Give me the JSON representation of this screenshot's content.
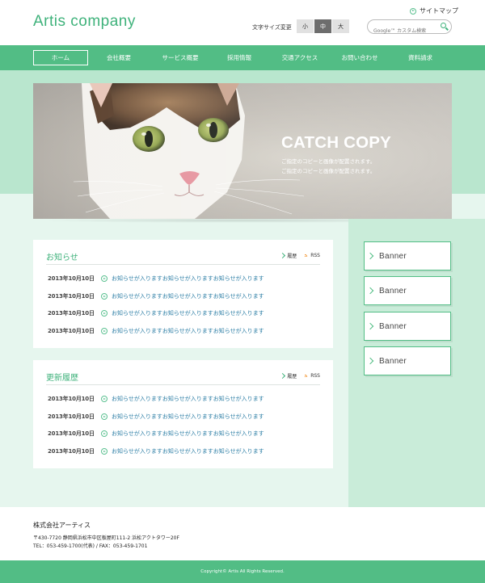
{
  "header": {
    "logo": "Artis company",
    "sitemap": "サイトマップ",
    "font_size_label": "文字サイズ変更",
    "font_sizes": [
      "小",
      "中",
      "大"
    ],
    "active_font_size": "中",
    "search_placeholder": "Google™ カスタム検索"
  },
  "nav": {
    "items": [
      "ホーム",
      "会社概要",
      "サービス概要",
      "採用情報",
      "交通アクセス",
      "お問い合わせ",
      "資料請求"
    ],
    "active": "ホーム"
  },
  "hero": {
    "catch_copy": "CATCH COPY",
    "sub_lines": [
      "ご指定のコピーと画像が配置されます。",
      "ご指定のコピーと画像が配置されます。"
    ]
  },
  "news": {
    "title": "お知らせ",
    "history_link": "履歴",
    "rss_link": "RSS",
    "items": [
      {
        "date": "2013年10月10日",
        "text": "お知らせが入りますお知らせが入りますお知らせが入ります"
      },
      {
        "date": "2013年10月10日",
        "text": "お知らせが入りますお知らせが入りますお知らせが入ります"
      },
      {
        "date": "2013年10月10日",
        "text": "お知らせが入りますお知らせが入りますお知らせが入ります"
      },
      {
        "date": "2013年10月10日",
        "text": "お知らせが入りますお知らせが入りますお知らせが入ります"
      }
    ]
  },
  "updates": {
    "title": "更新履歴",
    "history_link": "履歴",
    "rss_link": "RSS",
    "items": [
      {
        "date": "2013年10月10日",
        "text": "お知らせが入りますお知らせが入りますお知らせが入ります"
      },
      {
        "date": "2013年10月10日",
        "text": "お知らせが入りますお知らせが入りますお知らせが入ります"
      },
      {
        "date": "2013年10月10日",
        "text": "お知らせが入りますお知らせが入りますお知らせが入ります"
      },
      {
        "date": "2013年10月10日",
        "text": "お知らせが入りますお知らせが入りますお知らせが入ります"
      }
    ]
  },
  "banners": [
    "Banner",
    "Banner",
    "Banner",
    "Banner"
  ],
  "footer": {
    "company": "株式会社アーティス",
    "address": "〒430-7720 静岡県浜松市中区板屋町111-2 浜松アクトタワー20F",
    "tel": "TEL：053-459-1700(代表) / FAX：053-459-1701",
    "copyright": "Copyright© Artis All Rights Reserved."
  },
  "colors": {
    "accent": "#52bd85",
    "logo": "#3fb27b",
    "link": "#2e7fa6",
    "band": "#b9e6ce",
    "background": "#e6f6ee"
  }
}
